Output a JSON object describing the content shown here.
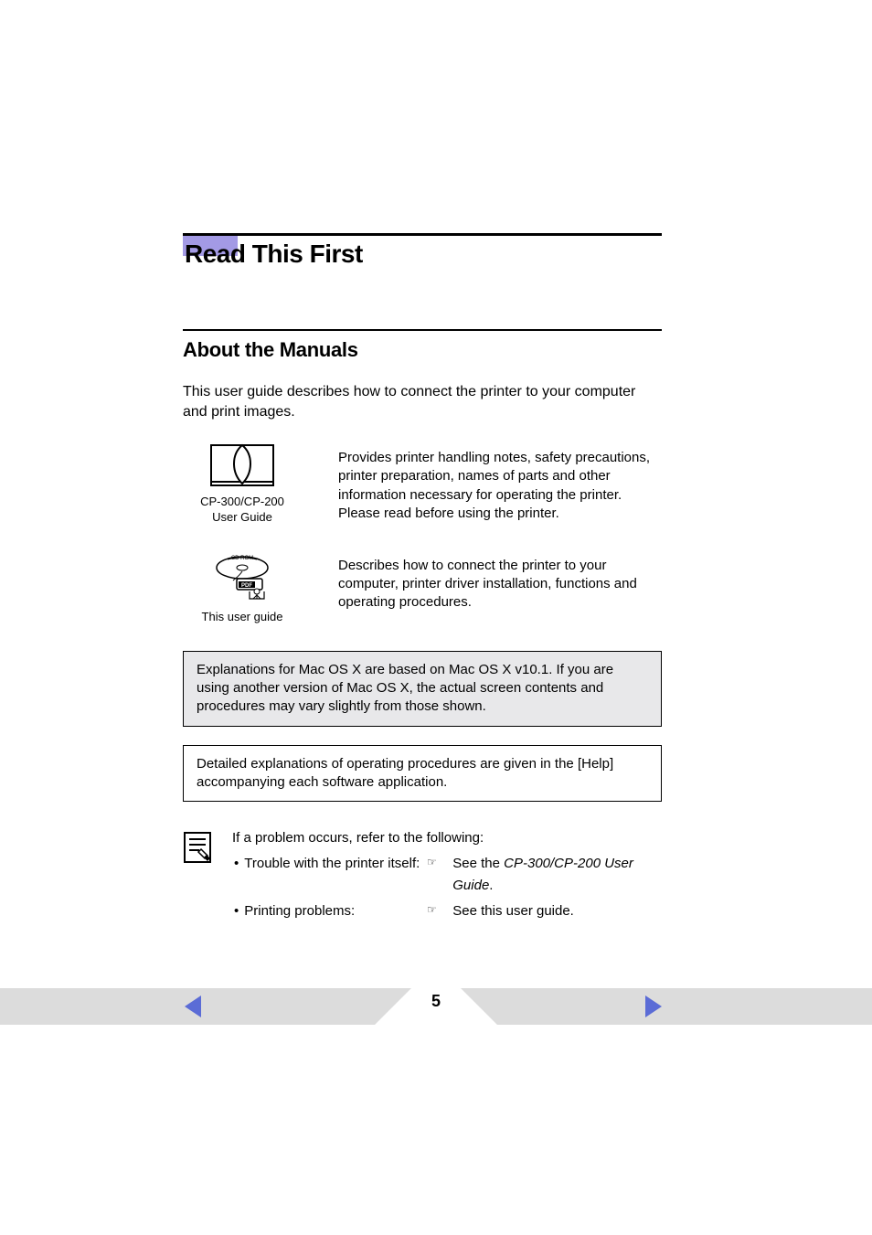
{
  "heading": "Read This First",
  "subheading": "About the Manuals",
  "intro": "This user guide describes how to connect the printer to your computer and print images.",
  "manuals": [
    {
      "caption": "CP-300/CP-200\nUser Guide",
      "desc": "Provides printer handling notes, safety precautions, printer preparation, names of parts and other information necessary for operating the printer. Please read before using the printer."
    },
    {
      "caption": "This user guide",
      "desc": "Describes how to connect the printer to your computer, printer driver installation, functions and operating procedures."
    }
  ],
  "notes": {
    "osx_note": "Explanations for Mac OS X are based on Mac OS X v10.1. If you are using another version of Mac OS X, the actual screen contents and procedures may vary slightly from those shown.",
    "help_note": "Detailed explanations of operating procedures are given in the [Help] accompanying each software application."
  },
  "troubleshoot": {
    "intro": "If a problem occurs, refer to the following:",
    "items": [
      {
        "label": "Trouble with the printer itself:",
        "ref_prefix": "See the ",
        "ref_italic": "CP-300/CP-200 User Guide",
        "ref_suffix": "."
      },
      {
        "label": "Printing problems:",
        "ref_prefix": "See this user guide.",
        "ref_italic": "",
        "ref_suffix": ""
      }
    ]
  },
  "page_number": "5"
}
